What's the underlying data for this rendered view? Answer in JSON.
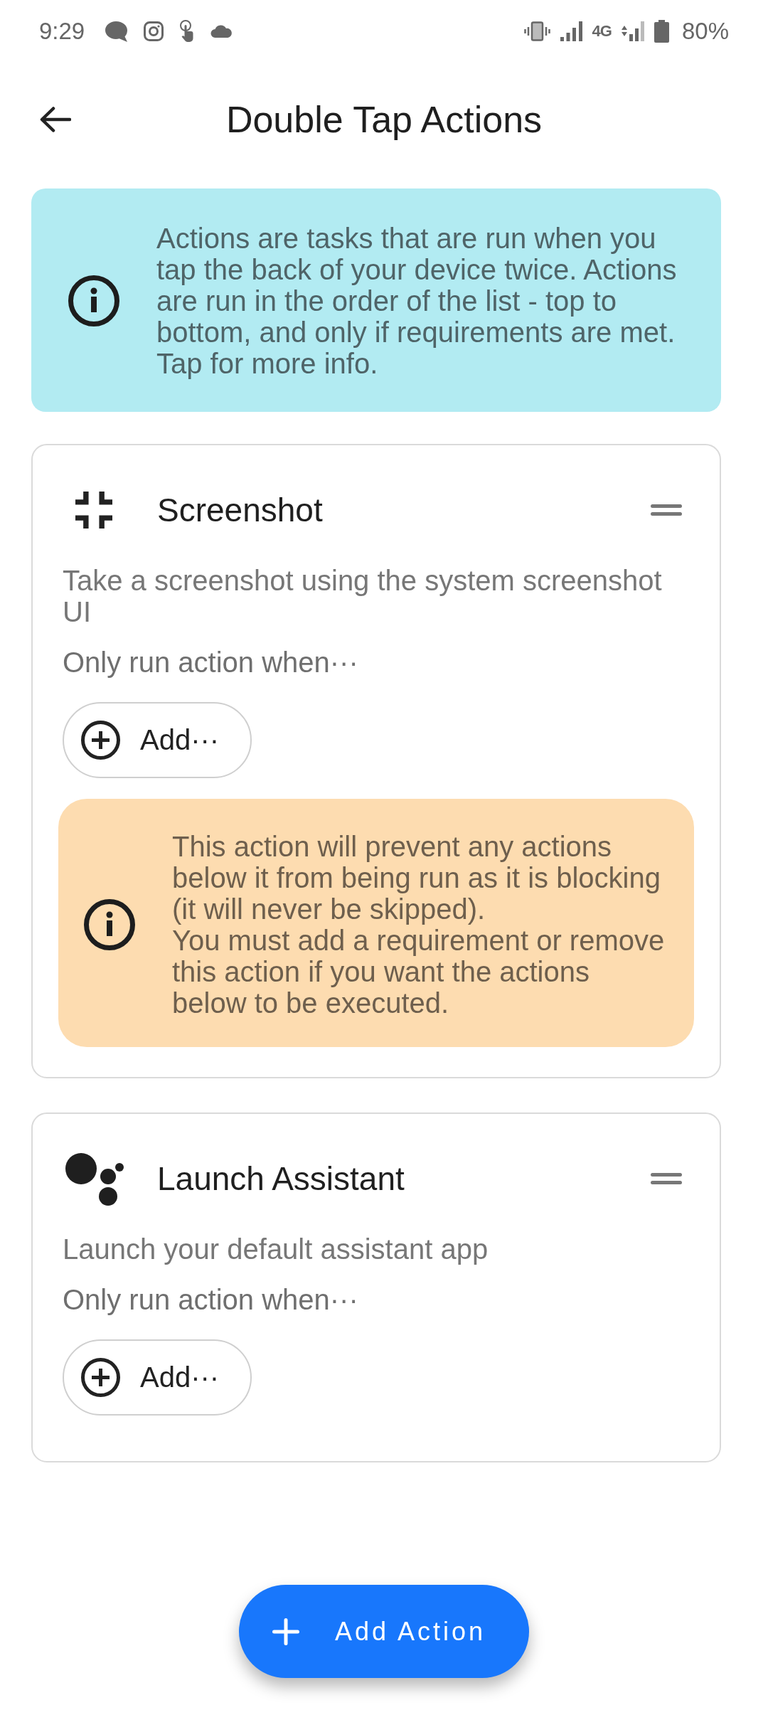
{
  "status_bar": {
    "time": "9:29",
    "network": "4G",
    "battery": "80%"
  },
  "header": {
    "title": "Double Tap Actions"
  },
  "info_banner": {
    "text": "Actions are tasks that are run when you tap the back of your device twice. Actions are run in the order of the list - top to bottom, and only if requirements are met. Tap for more info."
  },
  "actions": [
    {
      "kind": "screenshot",
      "title": "Screenshot",
      "description": "Take a screenshot using the system screenshot UI",
      "condition_label": "Only run action when···",
      "add_button": "Add···",
      "warning": "This action will prevent any actions below it from being run as it is blocking (it will never be skipped).\nYou must add a requirement or remove this action if you want the actions below to be executed."
    },
    {
      "kind": "assistant",
      "title": "Launch Assistant",
      "description": "Launch your default assistant app",
      "condition_label": "Only run action when···",
      "add_button": "Add···"
    }
  ],
  "fab": {
    "label": "Add Action"
  }
}
